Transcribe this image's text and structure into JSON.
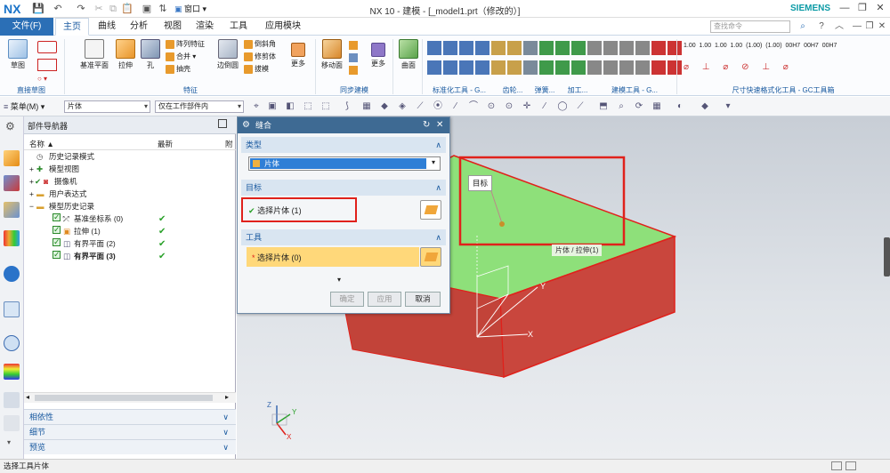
{
  "app": {
    "logo": "NX",
    "title": "NX 10 - 建模 - [_model1.prt（修改的）]",
    "brand": "SIEMENS",
    "window_menu": "窗口"
  },
  "tabs": {
    "file": "文件(F)",
    "items": [
      "主页",
      "曲线",
      "分析",
      "视图",
      "渲染",
      "工具",
      "应用模块"
    ],
    "search_placeholder": "查找命令"
  },
  "ribbon": {
    "sketch": {
      "btn": "草图",
      "group": "直接草图"
    },
    "feature": {
      "datum_plane": "基准平面",
      "extrude": "拉伸",
      "hole": "孔",
      "pattern_feature": "阵列特征",
      "unite": "合并",
      "shell": "抽壳",
      "edge_blend": "边倒圆",
      "chamfer": "倒斜角",
      "trim_body": "修剪体",
      "draft": "拔模",
      "more": "更多",
      "group": "特征"
    },
    "sync": {
      "move_face": "移动面",
      "more": "更多",
      "group": "同步建模"
    },
    "surface": {
      "btn": "曲面"
    },
    "groups_right": [
      "标准化工具 - G...",
      "齿轮...",
      "弹簧...",
      "加工...",
      "建模工具 - G...",
      "尺寸快速格式化工具 - GC工具箱"
    ],
    "dim_labels": [
      "1.00",
      "1.00",
      "1.00",
      "1.00",
      "(1.00)",
      "(1.00)",
      "00H7",
      "00H7",
      "00H7"
    ]
  },
  "selection_bar": {
    "menu": "菜单(M)",
    "type_filter": "片体",
    "scope": "仅在工作部件内"
  },
  "navigator": {
    "title": "部件导航器",
    "col_name": "名称",
    "col_latest": "最新",
    "col_extra": "附",
    "rows": [
      {
        "label": "历史记录模式",
        "ok": false
      },
      {
        "label": "模型视图",
        "ok": false
      },
      {
        "label": "摄像机",
        "ok": false
      },
      {
        "label": "用户表达式",
        "ok": false
      },
      {
        "label": "模型历史记录",
        "ok": false
      },
      {
        "label": "基准坐标系 (0)",
        "ok": true
      },
      {
        "label": "拉伸 (1)",
        "ok": true
      },
      {
        "label": "有界平面 (2)",
        "ok": true
      },
      {
        "label": "有界平面 (3)",
        "ok": true
      }
    ],
    "sections": [
      "相依性",
      "细节",
      "预览"
    ]
  },
  "dialog": {
    "title": "缝合",
    "type_section": "类型",
    "type_value": "片体",
    "target_section": "目标",
    "target_select": "选择片体 (1)",
    "tool_section": "工具",
    "tool_select": "选择片体 (0)",
    "btn_ok": "确定",
    "btn_apply": "应用",
    "btn_cancel": "取消"
  },
  "viewport": {
    "tooltip_target": "目标",
    "face_label": "片体 / 拉伸(1)",
    "axis_x": "X",
    "axis_y": "Y",
    "triad_x": "X",
    "triad_y": "Y",
    "triad_z": "Z"
  },
  "status": {
    "text": "选择工具片体"
  },
  "colors": {
    "accent": "#2b6fb6",
    "face_green": "#8ee07a",
    "body_red": "#c9463d",
    "highlight_red": "#e0211b"
  }
}
